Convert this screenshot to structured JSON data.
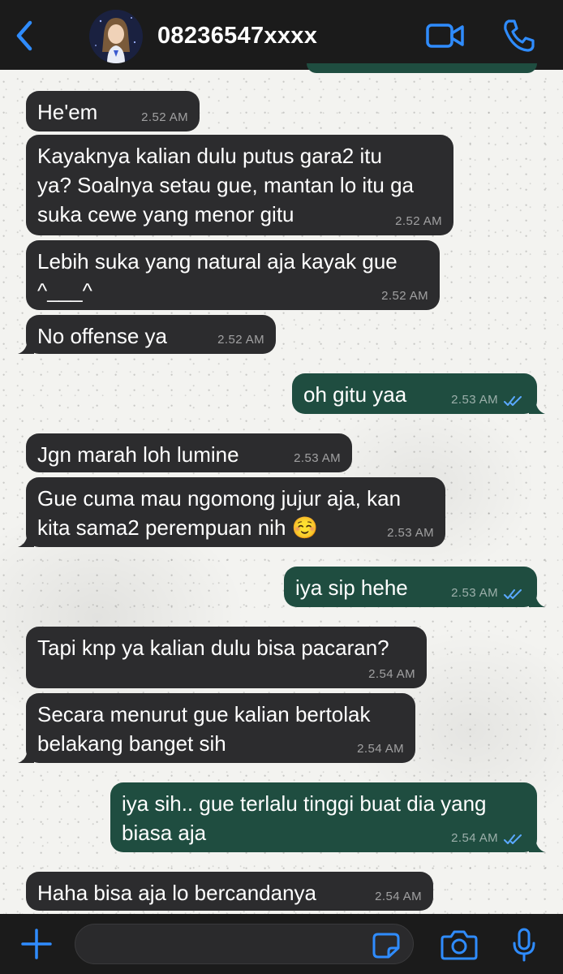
{
  "header": {
    "contact_name": "08236547xxxx",
    "icons": {
      "back": "chevron-left-icon",
      "video": "video-camera-icon",
      "call": "phone-icon"
    },
    "accent_color": "#2f8cff"
  },
  "messages": [
    {
      "direction": "in",
      "text": "He'em",
      "time": "2.52 AM"
    },
    {
      "direction": "in",
      "text": "Kayaknya kalian dulu putus gara2 itu\nya? Soalnya setau gue, mantan lo itu ga\nsuka cewe yang menor gitu",
      "time": "2.52 AM"
    },
    {
      "direction": "in",
      "text": "Lebih suka yang natural aja kayak gue\n^___^",
      "time": "2.52 AM"
    },
    {
      "direction": "in",
      "text": "No offense ya",
      "time": "2.52 AM"
    },
    {
      "direction": "out",
      "text": "oh gitu yaa",
      "time": "2.53 AM",
      "status": "read"
    },
    {
      "direction": "in",
      "text": "Jgn marah loh lumine",
      "time": "2.53 AM"
    },
    {
      "direction": "in",
      "text": "Gue cuma mau ngomong jujur aja, kan\nkita sama2 perempuan nih ☺️",
      "time": "2.53 AM"
    },
    {
      "direction": "out",
      "text": "iya sip hehe",
      "time": "2.53 AM",
      "status": "read"
    },
    {
      "direction": "in",
      "text": "Tapi knp ya kalian dulu bisa pacaran?",
      "time": "2.54 AM"
    },
    {
      "direction": "in",
      "text": "Secara menurut gue kalian bertolak\nbelakang banget sih",
      "time": "2.54 AM"
    },
    {
      "direction": "out",
      "text": "iya sih.. gue terlalu tinggi buat dia yang\nbiasa aja",
      "time": "2.54 AM",
      "status": "read"
    },
    {
      "direction": "in",
      "text": "Haha bisa aja lo bercandanya",
      "time": "2.54 AM"
    }
  ],
  "colors": {
    "incoming_bubble": "#2c2c2e",
    "outgoing_bubble": "#1f4d40",
    "read_ticks": "#5aa9ff"
  },
  "footer": {
    "input_value": "",
    "icons": {
      "plus": "plus-icon",
      "sticker": "sticker-icon",
      "camera": "camera-icon",
      "mic": "microphone-icon"
    }
  }
}
